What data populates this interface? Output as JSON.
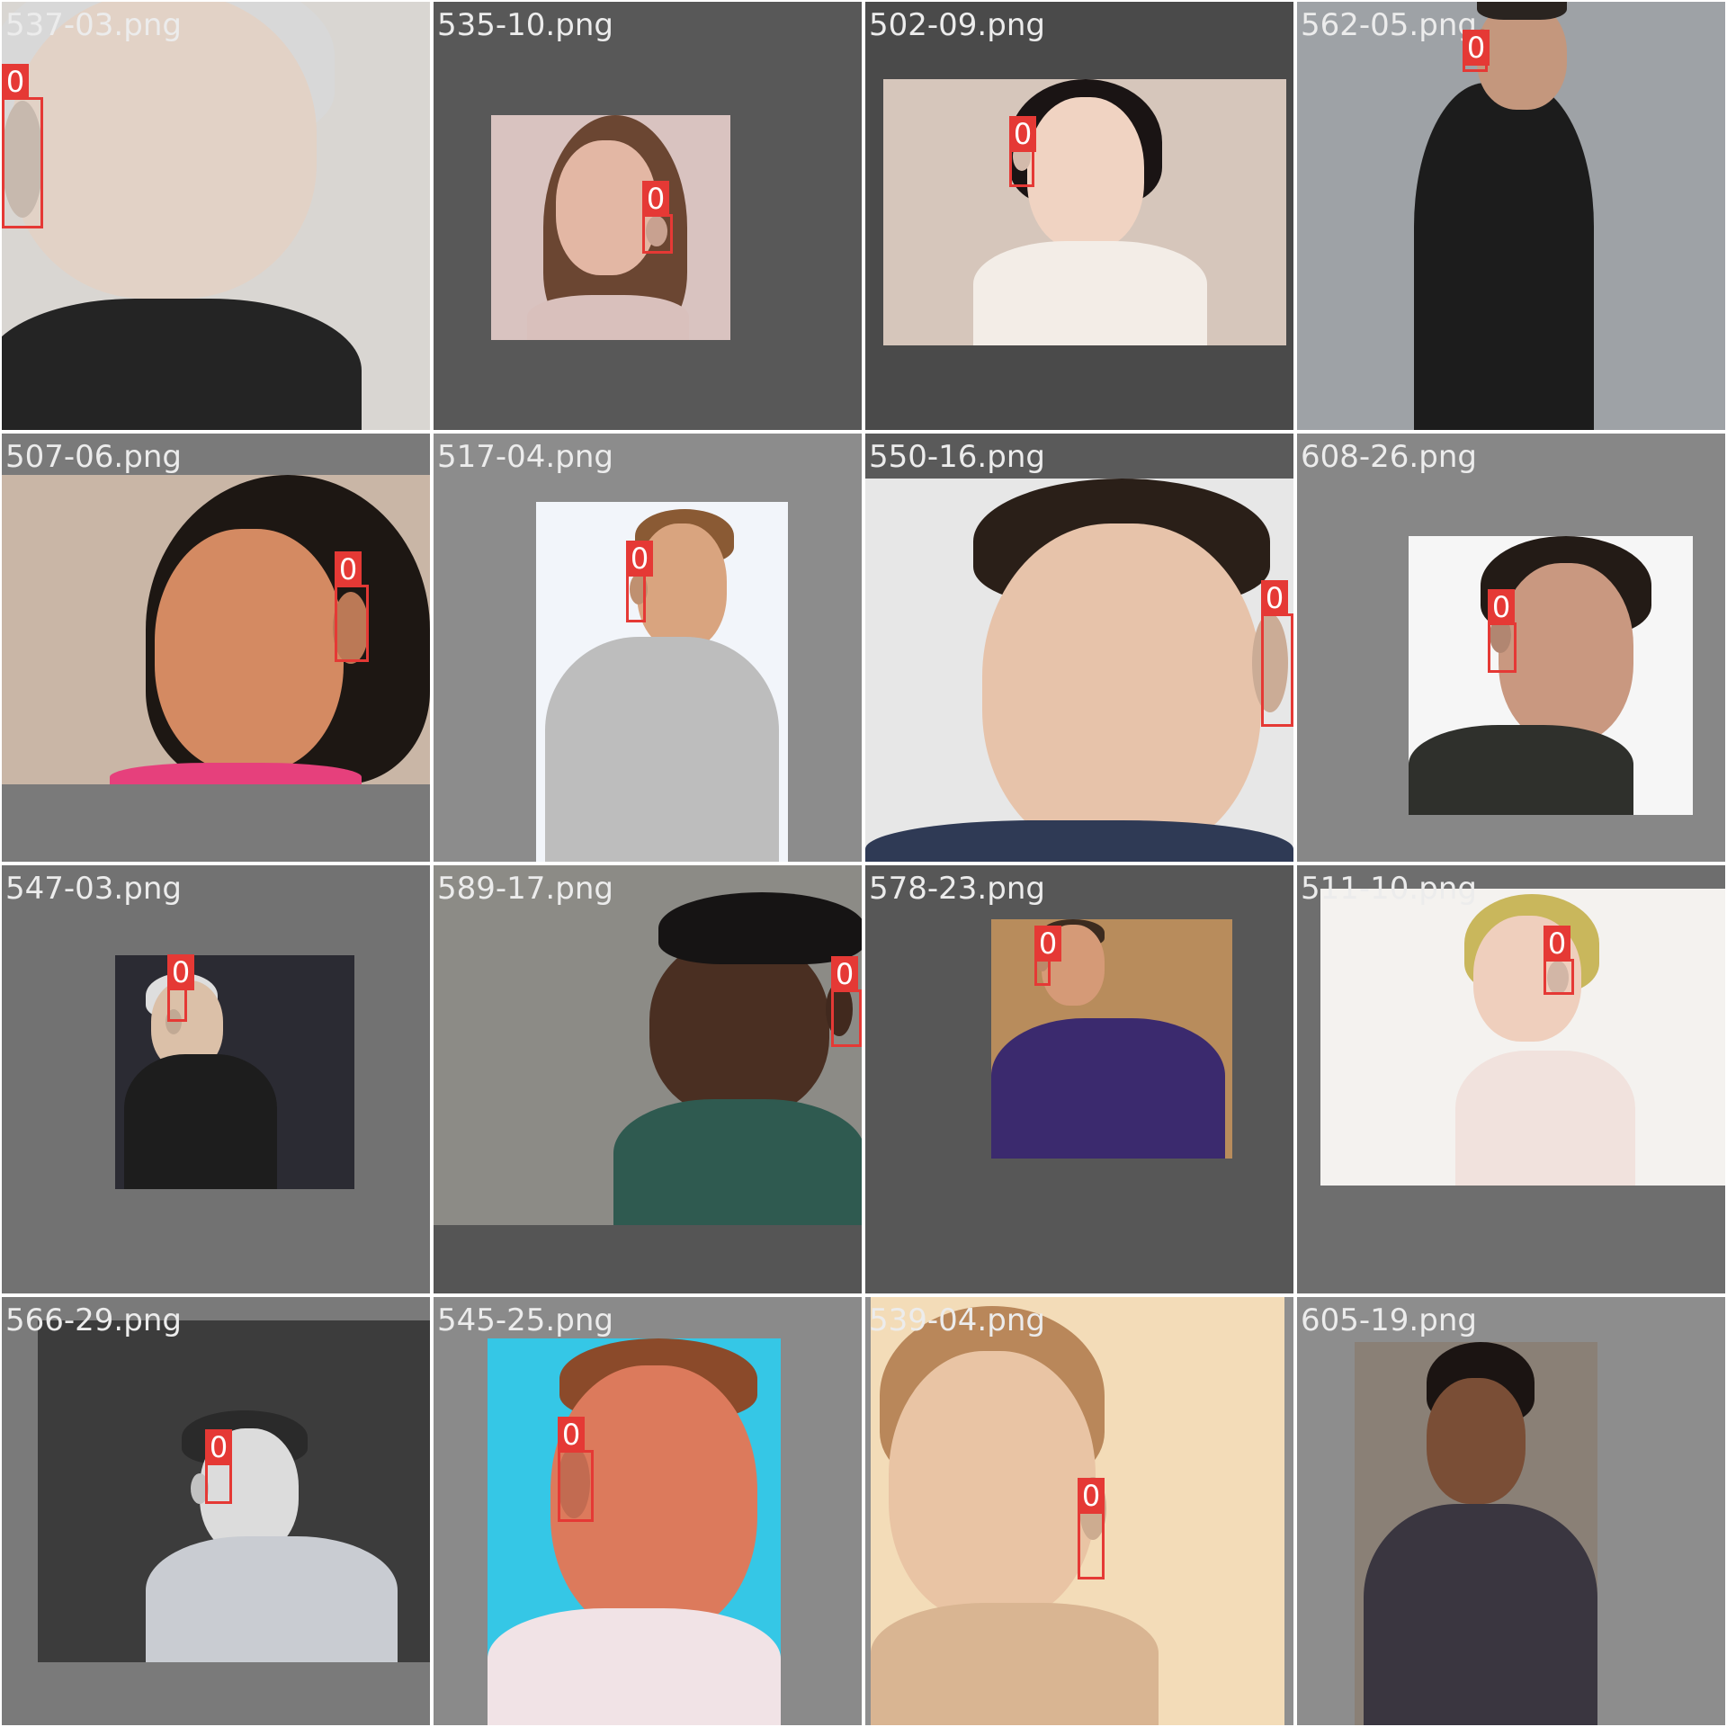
{
  "tiles": [
    {
      "filename": "537-03.png",
      "box_label": "0",
      "bg": "#3a3a3a",
      "photo_bg": "#d9d6d2",
      "skin": "#e2d2c6",
      "hair": "#d8d8d8",
      "clothing": "#242424"
    },
    {
      "filename": "535-10.png",
      "box_label": "0",
      "bg": "#585858",
      "photo_bg": "#d9c3c0",
      "skin": "#e3b7a4",
      "hair": "#6b4632",
      "clothing": "#d9c0bc"
    },
    {
      "filename": "502-09.png",
      "box_label": "0",
      "bg": "#4a4a4a",
      "photo_bg": "#d6c6bb",
      "skin": "#f0d3c2",
      "hair": "#1a1414",
      "clothing": "#f3ede7"
    },
    {
      "filename": "562-05.png",
      "box_label": "0",
      "bg": "#5e5e5e",
      "photo_bg": "#9ea2a6",
      "skin": "#c4977d",
      "hair": "#2a2420",
      "clothing": "#1c1c1c"
    },
    {
      "filename": "507-06.png",
      "box_label": "0",
      "bg": "#7a7a7a",
      "photo_bg": "#c9b6a6",
      "skin": "#d48a62",
      "hair": "#1d1713",
      "clothing": "#e6407c"
    },
    {
      "filename": "517-04.png",
      "box_label": "0",
      "bg": "#8c8c8c",
      "photo_bg": "#f2f5fa",
      "skin": "#d9a47f",
      "hair": "#8a5a34",
      "clothing": "#bdbdbd"
    },
    {
      "filename": "550-16.png",
      "box_label": "0",
      "bg": "#5a5a5a",
      "photo_bg": "#e7e7e7",
      "skin": "#e7c3aa",
      "hair": "#2a1f18",
      "clothing": "#2f3a55"
    },
    {
      "filename": "608-26.png",
      "box_label": "0",
      "bg": "#878787",
      "photo_bg": "#f6f6f6",
      "skin": "#c99880",
      "hair": "#231b16",
      "clothing": "#2f302c"
    },
    {
      "filename": "547-03.png",
      "box_label": "0",
      "bg": "#727272",
      "photo_bg": "#2b2b33",
      "skin": "#dbc0a8",
      "hair": "#dedede",
      "clothing": "#1d1d1d"
    },
    {
      "filename": "589-17.png",
      "box_label": "0",
      "bg": "#555555",
      "photo_bg": "#8c8b86",
      "skin": "#4a2f22",
      "hair": "#161414",
      "clothing": "#2f5a50"
    },
    {
      "filename": "578-23.png",
      "box_label": "0",
      "bg": "#575757",
      "photo_bg": "#b88c5c",
      "skin": "#d59a77",
      "hair": "#3c2b1f",
      "clothing": "#3b2a6e"
    },
    {
      "filename": "511-10.png",
      "box_label": "0",
      "bg": "#6e6e6e",
      "photo_bg": "#f4f2ef",
      "skin": "#efcfbd",
      "hair": "#c9b75c",
      "clothing": "#f1e2dd"
    },
    {
      "filename": "566-29.png",
      "box_label": "0",
      "bg": "#7a7a7a",
      "photo_bg": "#3c3c3c",
      "skin": "#dcdcdc",
      "hair": "#2a2a2a",
      "clothing": "#c9ccd2"
    },
    {
      "filename": "545-25.png",
      "box_label": "0",
      "bg": "#8a8a8a",
      "photo_bg": "#35c7e6",
      "skin": "#dc7a5c",
      "hair": "#8b4a2a",
      "clothing": "#f1e3e6"
    },
    {
      "filename": "539-04.png",
      "box_label": "0",
      "bg": "#8f8f8f",
      "photo_bg": "#f3dcb8",
      "skin": "#e9c4a4",
      "hair": "#b9875a",
      "clothing": "#d9b592"
    },
    {
      "filename": "605-19.png",
      "box_label": "0",
      "bg": "#8d8d8d",
      "photo_bg": "#8a8076",
      "skin": "#7a4e36",
      "hair": "#1b1412",
      "clothing": "#3a3640"
    }
  ]
}
